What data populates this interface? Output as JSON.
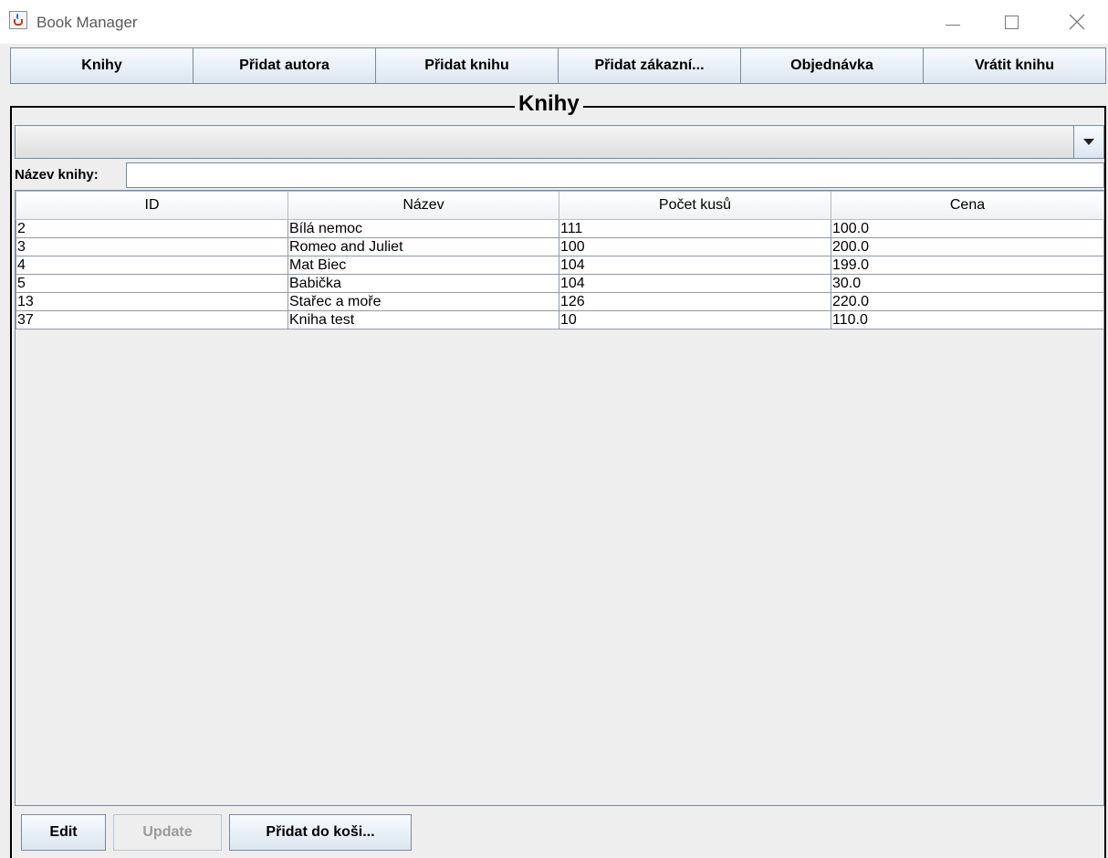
{
  "window": {
    "title": "Book Manager"
  },
  "toolbar": {
    "buttons": [
      "Knihy",
      "Přidat autora",
      "Přidat knihu",
      "Přidat zákazní...",
      "Objednávka",
      "Vrátit knihu"
    ]
  },
  "panel": {
    "title": "Knihy"
  },
  "combo": {
    "selected": ""
  },
  "search": {
    "label": "Název knihy:",
    "value": ""
  },
  "table": {
    "columns": [
      "ID",
      "Název",
      "Počet kusů",
      "Cena"
    ],
    "rows": [
      [
        "2",
        "Bílá nemoc",
        "111",
        "100.0"
      ],
      [
        "3",
        "Romeo and Juliet",
        "100",
        "200.0"
      ],
      [
        "4",
        "Mat Biec",
        "104",
        "199.0"
      ],
      [
        "5",
        "Babička",
        "104",
        "30.0"
      ],
      [
        "13",
        "Stařec a moře",
        "126",
        "220.0"
      ],
      [
        "37",
        "Kniha test",
        "10",
        "110.0"
      ]
    ]
  },
  "actions": {
    "edit": "Edit",
    "update": "Update",
    "add_to_cart": "Přidat do koši..."
  },
  "icons": {
    "app": "java-cup-icon",
    "combo_arrow": "chevron-down-icon"
  }
}
